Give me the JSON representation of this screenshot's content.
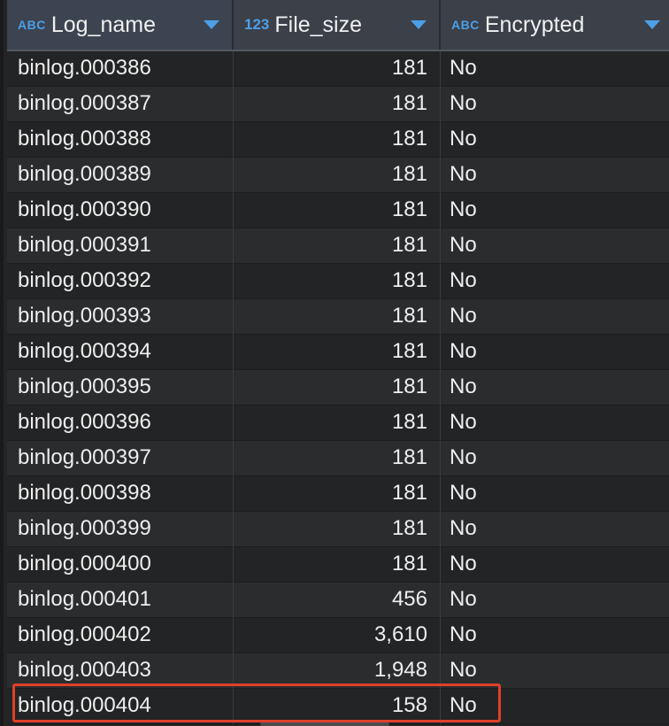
{
  "columns": [
    {
      "type": "ABC",
      "label": "Log_name"
    },
    {
      "type": "123",
      "label": "File_size"
    },
    {
      "type": "ABC",
      "label": "Encrypted"
    }
  ],
  "rows": [
    {
      "log_name": "binlog.000386",
      "file_size": "181",
      "encrypted": "No"
    },
    {
      "log_name": "binlog.000387",
      "file_size": "181",
      "encrypted": "No"
    },
    {
      "log_name": "binlog.000388",
      "file_size": "181",
      "encrypted": "No"
    },
    {
      "log_name": "binlog.000389",
      "file_size": "181",
      "encrypted": "No"
    },
    {
      "log_name": "binlog.000390",
      "file_size": "181",
      "encrypted": "No"
    },
    {
      "log_name": "binlog.000391",
      "file_size": "181",
      "encrypted": "No"
    },
    {
      "log_name": "binlog.000392",
      "file_size": "181",
      "encrypted": "No"
    },
    {
      "log_name": "binlog.000393",
      "file_size": "181",
      "encrypted": "No"
    },
    {
      "log_name": "binlog.000394",
      "file_size": "181",
      "encrypted": "No"
    },
    {
      "log_name": "binlog.000395",
      "file_size": "181",
      "encrypted": "No"
    },
    {
      "log_name": "binlog.000396",
      "file_size": "181",
      "encrypted": "No"
    },
    {
      "log_name": "binlog.000397",
      "file_size": "181",
      "encrypted": "No"
    },
    {
      "log_name": "binlog.000398",
      "file_size": "181",
      "encrypted": "No"
    },
    {
      "log_name": "binlog.000399",
      "file_size": "181",
      "encrypted": "No"
    },
    {
      "log_name": "binlog.000400",
      "file_size": "181",
      "encrypted": "No"
    },
    {
      "log_name": "binlog.000401",
      "file_size": "456",
      "encrypted": "No"
    },
    {
      "log_name": "binlog.000402",
      "file_size": "3,610",
      "encrypted": "No"
    },
    {
      "log_name": "binlog.000403",
      "file_size": "1,948",
      "encrypted": "No"
    },
    {
      "log_name": "binlog.000404",
      "file_size": "158",
      "encrypted": "No"
    }
  ],
  "colors": {
    "header_bg": "#3b4049",
    "type_icon": "#4d9fe6",
    "highlight_border": "#e0402a"
  }
}
